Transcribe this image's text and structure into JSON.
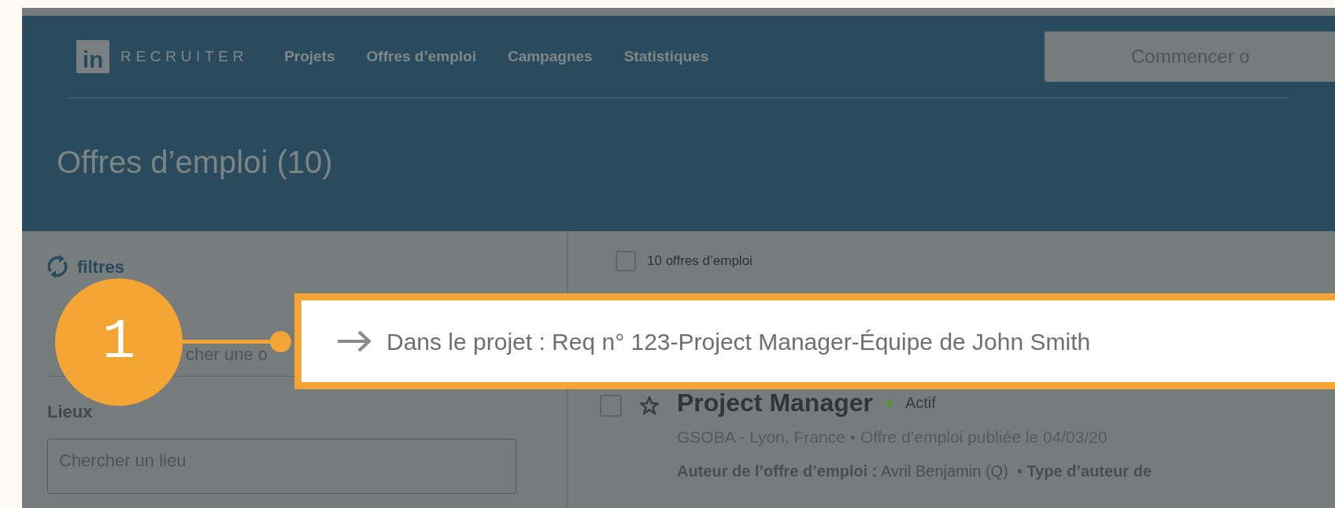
{
  "logo": {
    "badge": "in",
    "text": "RECRUITER"
  },
  "nav": [
    {
      "label": "Projets"
    },
    {
      "label": "Offres d’emploi"
    },
    {
      "label": "Campagnes"
    },
    {
      "label": "Statistiques"
    }
  ],
  "header_button": {
    "label": "Commencer o"
  },
  "page_title": "Offres d’emploi (10)",
  "filters": {
    "label": "filtres",
    "search_placeholder": "cher une o",
    "locations_label": "Lieux",
    "location_placeholder": "Chercher un lieu"
  },
  "list": {
    "select_all": {
      "label": "10 offres d’emploi",
      "checked": false
    },
    "jobs": [
      {
        "title": "Project Manager",
        "checked": false,
        "starred": false,
        "status": "Actif",
        "color": "#5a8f45",
        "details": "GSOBA - Lyon, France • Offre d’emploi publiée le 04/03/20",
        "meta": "**Auteur de l’offre d’emploi :** Avril Benjamin (Q)  • **Type d’auteur de**"
      }
    ]
  },
  "callout": {
    "number": "1",
    "text": "Dans le projet : Req n° 123-Project Manager-Équipe de John Smith"
  }
}
